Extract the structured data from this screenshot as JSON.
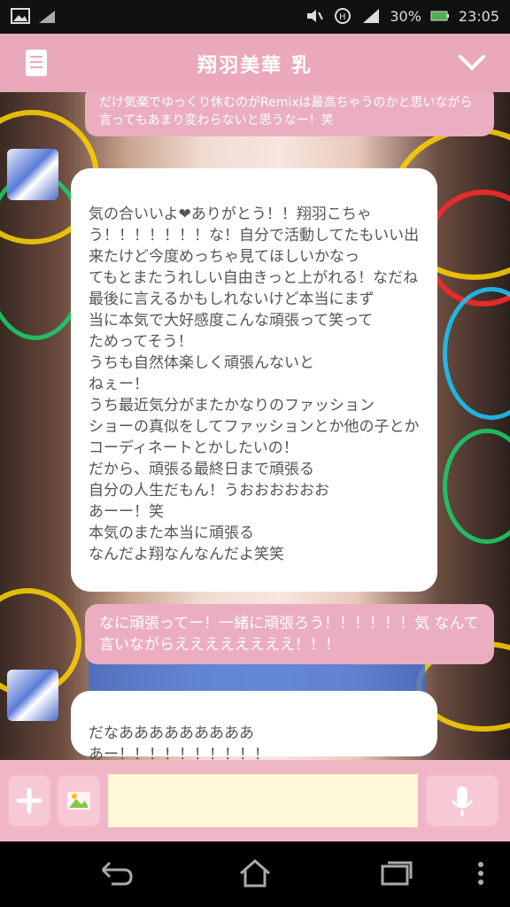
{
  "status": {
    "carrier_label": "",
    "battery": "30%",
    "time": "23:05"
  },
  "header": {
    "title": "翔羽美華 乳"
  },
  "messages": [
    {
      "side": "right",
      "text": "だけ気楽でゆっくり休むのがRemixは最高ちゃうのかと思いながら言ってもあまり変わらないと思うなー！笑"
    },
    {
      "side": "left",
      "sender": "",
      "text": "気の合いいよ❤ありがとう！！翔羽こちゃ\nう！！！！！！！な！自分で活動してたもいい出来たけど今度めっちゃ見てほしいかなっ\nてもとまたうれしい自由きっと上がれる！なだね\n最後に言えるかもしれないけど本当にまず\n当に本気で大好感度こんな頑張って笑って\nためってそう！\nうちも自然体楽しく頑張んないと\nねぇー！\nうち最近気分がまたかなりのファッション\nショーの真似をしてファッションとか他の子とか\nコーディネートとかしたいの！\nだから、頑張る最終日まで頑張る\n自分の人生だもん！うおおおおおお\nあーー！笑\n本気のまた本当に頑張る\nなんだよ翔なんなんだよ笑笑"
    },
    {
      "side": "right",
      "text": "なに頑張ってー！一緒に頑張ろう！！！！！！気\nなんて言いながらええええええええ！！！"
    },
    {
      "side": "left",
      "sender": "",
      "text": "だなあああああああああ\nあー！！！！！！！！！！"
    }
  ],
  "input": {
    "placeholder": ""
  },
  "icons": {
    "menu": "document-icon",
    "collapse": "chevron-down-icon",
    "add": "plus-icon",
    "image": "image-icon",
    "mic": "microphone-icon",
    "back": "back-icon",
    "home": "home-icon",
    "recent": "recent-apps-icon",
    "more": "more-vertical-icon"
  },
  "colors": {
    "header": "#e9a9bb",
    "bubble_right": "#ebaec0",
    "bubble_left": "#ffffff",
    "input_field": "#fff8d8"
  }
}
